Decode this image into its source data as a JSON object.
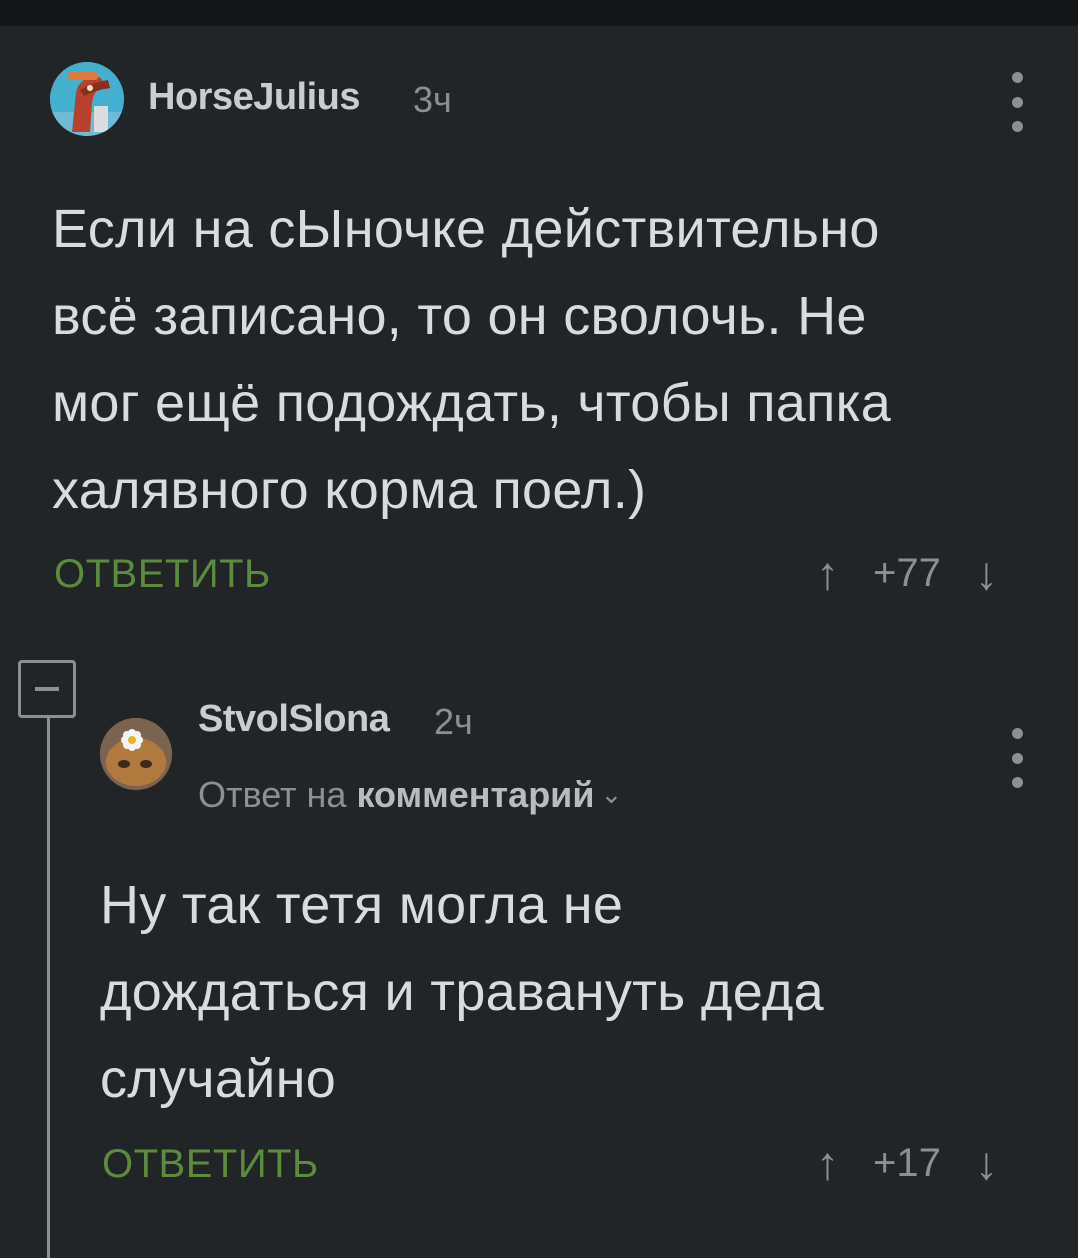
{
  "comments": [
    {
      "username": "HorseJulius",
      "time": "3ч",
      "avatar": "horse-avatar",
      "text_lines": [
        "Если на сЫночке действительно",
        "всё записано, то он сволочь. Не",
        "мог ещё подождать, чтобы папка",
        "халявного корма поел.)"
      ],
      "reply_label": "ОТВЕТИТЬ",
      "vote_up": "↑",
      "rating": "+77",
      "vote_down": "↓"
    },
    {
      "username": "StvolSlona",
      "time": "2ч",
      "avatar": "cat-avatar",
      "reply_prefix": "Ответ на",
      "reply_target": "комментарий",
      "text_lines": [
        "Ну так тетя могла не",
        "дождаться и травануть деда",
        "случайно"
      ],
      "reply_label": "ОТВЕТИТЬ",
      "vote_up": "↑",
      "rating": "+17",
      "vote_down": "↓"
    }
  ],
  "colors": {
    "background": "#222528",
    "accent_green": "#5d8b3e",
    "muted": "#8b9095"
  },
  "icons": {
    "collapse": "minus-square-icon",
    "more": "kebab-menu-icon",
    "upvote": "arrow-up-icon",
    "downvote": "arrow-down-icon",
    "expand_reply": "chevron-down-icon"
  }
}
